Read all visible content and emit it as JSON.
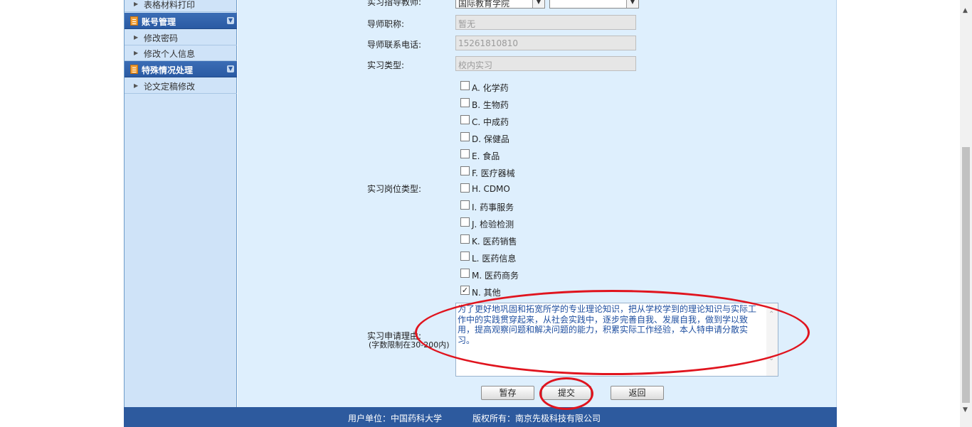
{
  "sidebar": {
    "items": [
      {
        "label": "表格材料打印"
      },
      {
        "label": "修改密码"
      },
      {
        "label": "修改个人信息"
      },
      {
        "label": "论文定稿修改"
      }
    ],
    "headers": [
      {
        "label": "账号管理"
      },
      {
        "label": "特殊情况处理"
      }
    ]
  },
  "form": {
    "supervisor_label": "实习指导教师:",
    "supervisor_college": "国际教育学院",
    "supervisor_name": "",
    "title_label": "导师职称:",
    "title_value": "暂无",
    "phone_label": "导师联系电话:",
    "phone_value": "15261810810",
    "type_label": "实习类型:",
    "type_value": "校内实习",
    "position_label": "实习岗位类型:",
    "position_options": [
      {
        "label": "A. 化学药",
        "checked": false
      },
      {
        "label": "B. 生物药",
        "checked": false
      },
      {
        "label": "C. 中成药",
        "checked": false
      },
      {
        "label": "D. 保健品",
        "checked": false
      },
      {
        "label": "E. 食品",
        "checked": false
      },
      {
        "label": "F. 医疗器械",
        "checked": false
      },
      {
        "label": "H. CDMO",
        "checked": false
      },
      {
        "label": "I. 药事服务",
        "checked": false
      },
      {
        "label": "J. 检验检测",
        "checked": false
      },
      {
        "label": "K. 医药销售",
        "checked": false
      },
      {
        "label": "L. 医药信息",
        "checked": false
      },
      {
        "label": "M. 医药商务",
        "checked": false
      },
      {
        "label": "N. 其他",
        "checked": true
      }
    ],
    "reason_label": "实习申请理由:",
    "reason_hint": "(字数限制在30-200内)",
    "reason_text": "为了更好地巩固和拓宽所学的专业理论知识，把从学校学到的理论知识与实际工作中的实践贯穿起来，从社会实践中，逐步完善自我、发展自我，做到学以致用，提高观察问题和解决问题的能力，积累实际工作经验，本人特申请分散实习。"
  },
  "buttons": {
    "save": "暂存",
    "submit": "提交",
    "back": "返回"
  },
  "footer": {
    "unit": "用户单位：中国药科大学",
    "copyright": "版权所有：南京先极科技有限公司"
  },
  "colors": {
    "annotation": "#e0141e",
    "header_blue": "#2d5a9e",
    "content_bg": "#deeffd",
    "sidebar_bg": "#cfe3f8"
  }
}
